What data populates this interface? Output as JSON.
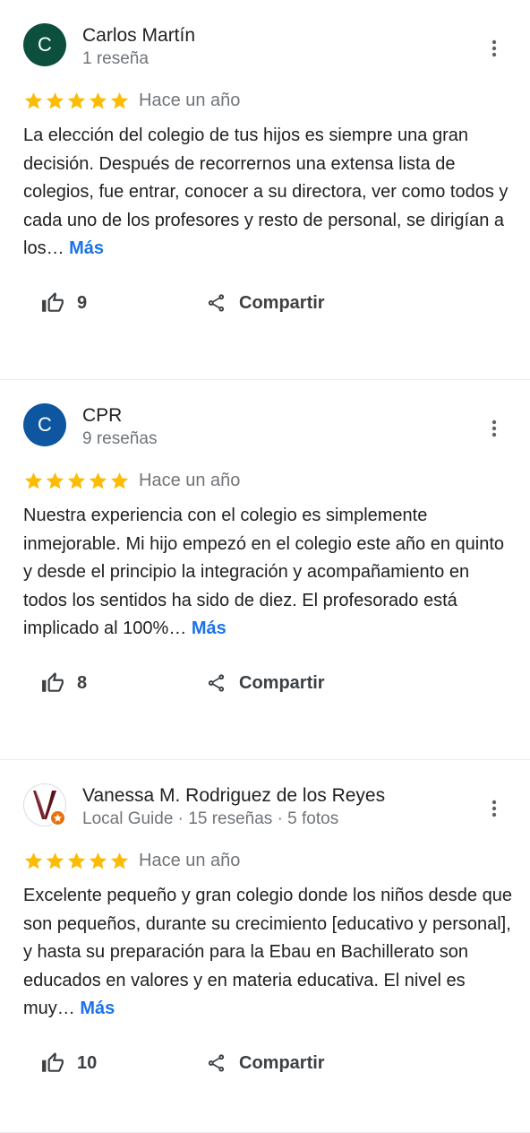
{
  "colors": {
    "star": "#fbbc04",
    "link": "#1a73e8",
    "secondary_text": "#70757a"
  },
  "reviews": [
    {
      "initial": "C",
      "avatar_color": "#0b4f3c",
      "author": "Carlos Martín",
      "meta": "1 reseña",
      "rating": 5,
      "time": "Hace un año",
      "text": "La elección del colegio de tus hijos es siempre una gran decisión. Después de recorrernos una extensa lista de colegios, fue entrar, conocer a su directora, ver como todos y cada uno de los profesores y resto de personal, se dirigían a los…",
      "more_label": "Más",
      "likes": "9",
      "share_label": "Compartir"
    },
    {
      "initial": "C",
      "avatar_color": "#0e57a0",
      "author": "CPR",
      "meta": "9 reseñas",
      "rating": 5,
      "time": "Hace un año",
      "text": "Nuestra experiencia con el colegio es simplemente inmejorable. Mi hijo empezó en el colegio este año en quinto y desde el principio la integración y acompañamiento en todos los sentidos ha sido de diez. El profesorado está implicado al 100%…",
      "more_label": "Más",
      "likes": "8",
      "share_label": "Compartir"
    },
    {
      "initial": "",
      "avatar_icon": "logo-v-icon",
      "author": "Vanessa M. Rodriguez de los Reyes",
      "meta": "Local Guide · 15 reseñas · 5 fotos",
      "rating": 5,
      "time": "Hace un año",
      "text": "Excelente pequeño y gran colegio donde los niños desde que son pequeños, durante su crecimiento [educativo y personal], y hasta su preparación para la Ebau en Bachillerato son educados en valores y en materia educativa. El nivel es muy…",
      "more_label": "Más",
      "likes": "10",
      "share_label": "Compartir"
    }
  ]
}
